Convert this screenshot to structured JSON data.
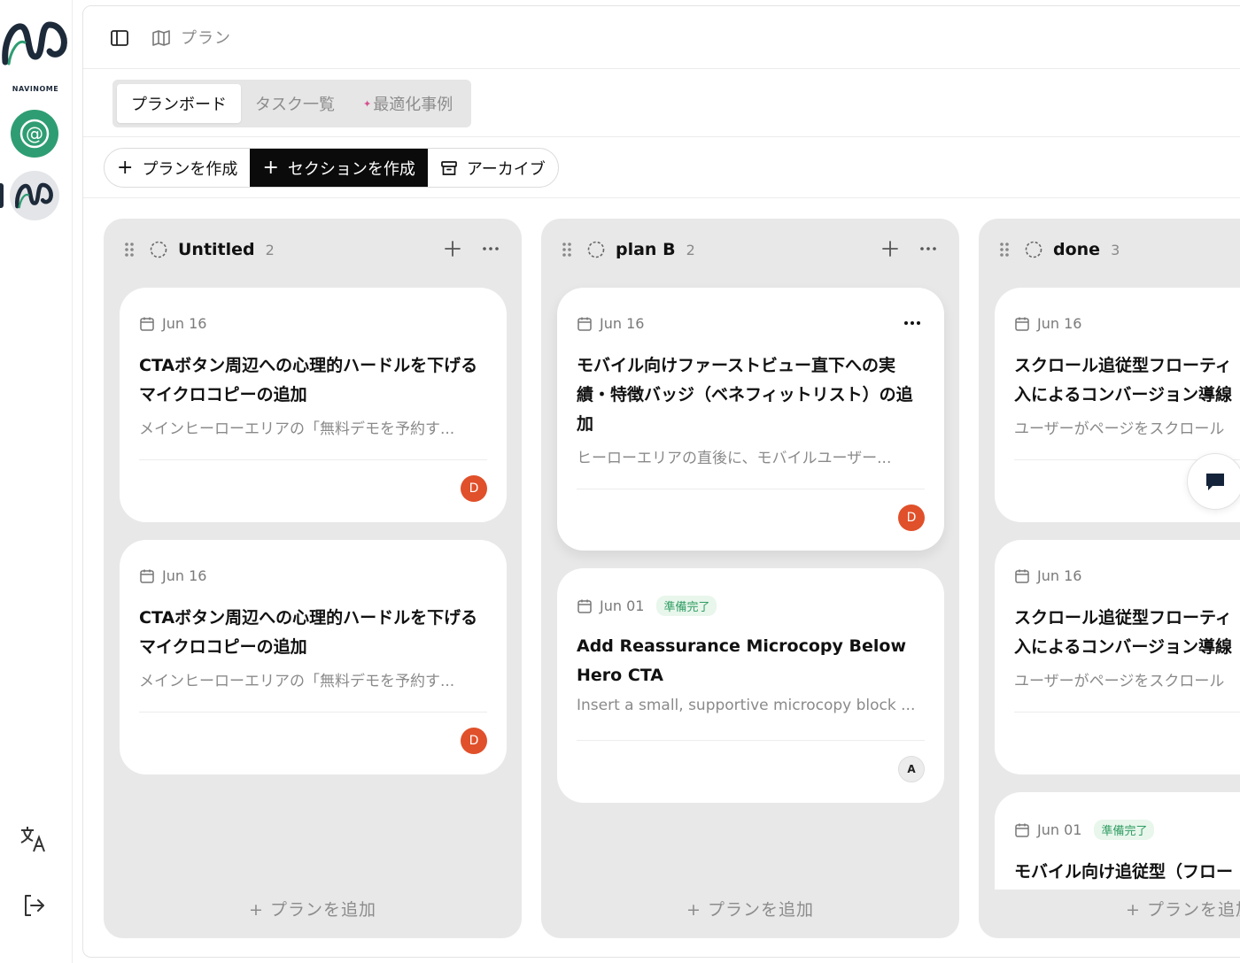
{
  "brand": {
    "logo_text": "NAVINOME"
  },
  "rail": {
    "accent": "#2f9d73"
  },
  "header": {
    "breadcrumb": "プラン"
  },
  "tabs": [
    {
      "label": "プランボード",
      "active": true
    },
    {
      "label": "タスク一覧",
      "active": false
    },
    {
      "label": "最適化事例",
      "active": false
    }
  ],
  "actions": {
    "create_plan": "プランを作成",
    "create_section": "セクションを作成",
    "archive": "アーカイブ"
  },
  "columns": [
    {
      "title": "Untitled",
      "count": "2",
      "add_label": "プランを追加",
      "cards": [
        {
          "date": "Jun 16",
          "title": "CTAボタン周辺への心理的ハードルを下げるマイクロコピーの追加",
          "desc": "メインヒーローエリアの「無料デモを予約す...",
          "avatar": "D"
        },
        {
          "date": "Jun 16",
          "title": "CTAボタン周辺への心理的ハードルを下げるマイクロコピーの追加",
          "desc": "メインヒーローエリアの「無料デモを予約す...",
          "avatar": "D"
        }
      ]
    },
    {
      "title": "plan B",
      "count": "2",
      "add_label": "プランを追加",
      "cards": [
        {
          "date": "Jun 16",
          "title": "モバイル向けファーストビュー直下への実績・特徴バッジ（ベネフィットリスト）の追加",
          "desc": "ヒーローエリアの直後に、モバイルユーザー...",
          "avatar": "D"
        },
        {
          "date": "Jun 01",
          "badge": "準備完了",
          "title": "Add Reassurance Microcopy Below Hero CTA",
          "desc": "Insert a small, supportive microcopy block ...",
          "avatar": "A"
        }
      ]
    },
    {
      "title": "done",
      "count": "3",
      "add_label": "プランを追加",
      "cards": [
        {
          "date": "Jun 16",
          "title": "スクロール追従型フローティ入によるコンバージョン導線",
          "desc": "ユーザーがページをスクロール"
        },
        {
          "date": "Jun 16",
          "title": "スクロール追従型フローティ入によるコンバージョン導線",
          "desc": "ユーザーがページをスクロール"
        },
        {
          "date": "Jun 01",
          "badge": "準備完了",
          "title": "モバイル向け追従型（フロー"
        }
      ]
    }
  ]
}
